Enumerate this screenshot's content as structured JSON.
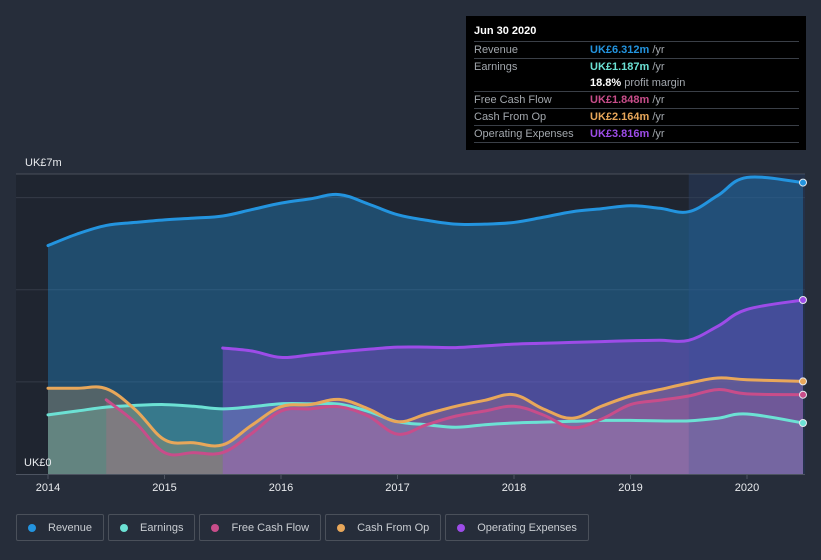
{
  "tooltip": {
    "date": "Jun 30 2020",
    "rows": [
      {
        "label": "Revenue",
        "value": "UK£6.312m",
        "unit": "/yr",
        "color": "#2394df"
      },
      {
        "label": "Earnings",
        "value": "UK£1.187m",
        "unit": "/yr",
        "color": "#6ce1d4"
      },
      {
        "label": "",
        "value": "18.8%",
        "unit": "profit margin",
        "color": "#ffffff"
      },
      {
        "label": "Free Cash Flow",
        "value": "UK£1.848m",
        "unit": "/yr",
        "color": "#c84d8a"
      },
      {
        "label": "Cash From Op",
        "value": "UK£2.164m",
        "unit": "/yr",
        "color": "#e8a75a"
      },
      {
        "label": "Operating Expenses",
        "value": "UK£3.816m",
        "unit": "/yr",
        "color": "#9d4ce8"
      }
    ]
  },
  "legend": [
    {
      "label": "Revenue",
      "color": "#2394df"
    },
    {
      "label": "Earnings",
      "color": "#6ce1d4"
    },
    {
      "label": "Free Cash Flow",
      "color": "#c84d8a"
    },
    {
      "label": "Cash From Op",
      "color": "#e8a75a"
    },
    {
      "label": "Operating Expenses",
      "color": "#9d4ce8"
    }
  ],
  "chart_data": {
    "type": "area",
    "title": "",
    "xlabel": "",
    "ylabel": "",
    "y_top_label": "UK£7m",
    "y_bottom_label": "UK£0",
    "ylim": [
      0,
      7
    ],
    "xlim": [
      2013.7,
      2020.5
    ],
    "x_ticks": [
      "2014",
      "2015",
      "2016",
      "2017",
      "2018",
      "2019",
      "2020"
    ],
    "gridlines_y": [
      0,
      2.15,
      4.3,
      6.45,
      7
    ],
    "highlight_start": 2019.5,
    "series": [
      {
        "name": "Revenue",
        "color": "#2394df",
        "x": [
          2014,
          2014.25,
          2014.5,
          2014.75,
          2015,
          2015.25,
          2015.5,
          2015.75,
          2016,
          2016.25,
          2016.5,
          2016.75,
          2017,
          2017.25,
          2017.5,
          2017.75,
          2018,
          2018.25,
          2018.5,
          2018.75,
          2019,
          2019.25,
          2019.5,
          2019.75,
          2020,
          2020.5
        ],
        "values": [
          5.33,
          5.6,
          5.8,
          5.87,
          5.93,
          5.97,
          6.02,
          6.17,
          6.32,
          6.42,
          6.52,
          6.3,
          6.05,
          5.92,
          5.83,
          5.83,
          5.87,
          5.99,
          6.12,
          6.19,
          6.26,
          6.2,
          6.12,
          6.5,
          6.92,
          6.8
        ]
      },
      {
        "name": "Earnings",
        "color": "#6ce1d4",
        "x": [
          2014,
          2014.25,
          2014.5,
          2014.75,
          2015,
          2015.25,
          2015.5,
          2015.75,
          2016,
          2016.25,
          2016.5,
          2016.75,
          2017,
          2017.25,
          2017.5,
          2017.75,
          2018,
          2018.25,
          2018.5,
          2018.75,
          2019,
          2019.25,
          2019.5,
          2019.75,
          2020,
          2020.5
        ],
        "values": [
          1.38,
          1.47,
          1.56,
          1.6,
          1.62,
          1.58,
          1.52,
          1.57,
          1.64,
          1.64,
          1.63,
          1.46,
          1.22,
          1.15,
          1.09,
          1.15,
          1.19,
          1.21,
          1.23,
          1.25,
          1.25,
          1.24,
          1.24,
          1.3,
          1.4,
          1.19
        ]
      },
      {
        "name": "Free Cash Flow",
        "color": "#c84d8a",
        "x": [
          2014.5,
          2014.75,
          2015,
          2015.25,
          2015.5,
          2015.75,
          2016,
          2016.25,
          2016.5,
          2016.75,
          2017,
          2017.25,
          2017.5,
          2017.75,
          2018,
          2018.25,
          2018.5,
          2018.75,
          2019,
          2019.25,
          2019.5,
          2019.75,
          2020,
          2020.5
        ],
        "values": [
          1.73,
          1.2,
          0.5,
          0.5,
          0.5,
          0.95,
          1.47,
          1.52,
          1.57,
          1.35,
          0.93,
          1.15,
          1.35,
          1.47,
          1.58,
          1.38,
          1.08,
          1.28,
          1.62,
          1.72,
          1.82,
          1.97,
          1.87,
          1.85
        ]
      },
      {
        "name": "Cash From Op",
        "color": "#e8a75a",
        "x": [
          2014,
          2014.25,
          2014.5,
          2014.75,
          2015,
          2015.25,
          2015.5,
          2015.75,
          2016,
          2016.25,
          2016.5,
          2016.75,
          2017,
          2017.25,
          2017.5,
          2017.75,
          2018,
          2018.25,
          2018.5,
          2018.75,
          2019,
          2019.25,
          2019.5,
          2019.75,
          2020,
          2020.5
        ],
        "values": [
          2.0,
          2.0,
          1.99,
          1.5,
          0.8,
          0.73,
          0.68,
          1.14,
          1.57,
          1.62,
          1.74,
          1.52,
          1.22,
          1.4,
          1.58,
          1.72,
          1.85,
          1.52,
          1.3,
          1.58,
          1.82,
          1.97,
          2.12,
          2.24,
          2.2,
          2.16
        ]
      },
      {
        "name": "Operating Expenses",
        "color": "#9d4ce8",
        "x": [
          2015.5,
          2015.75,
          2016,
          2016.25,
          2016.5,
          2016.75,
          2017,
          2017.25,
          2017.5,
          2017.75,
          2018,
          2018.25,
          2018.5,
          2018.75,
          2019,
          2019.25,
          2019.5,
          2019.75,
          2020,
          2020.5
        ],
        "values": [
          2.94,
          2.87,
          2.72,
          2.78,
          2.85,
          2.91,
          2.96,
          2.96,
          2.95,
          2.99,
          3.03,
          3.05,
          3.07,
          3.09,
          3.11,
          3.12,
          3.12,
          3.45,
          3.84,
          4.06
        ]
      }
    ]
  }
}
